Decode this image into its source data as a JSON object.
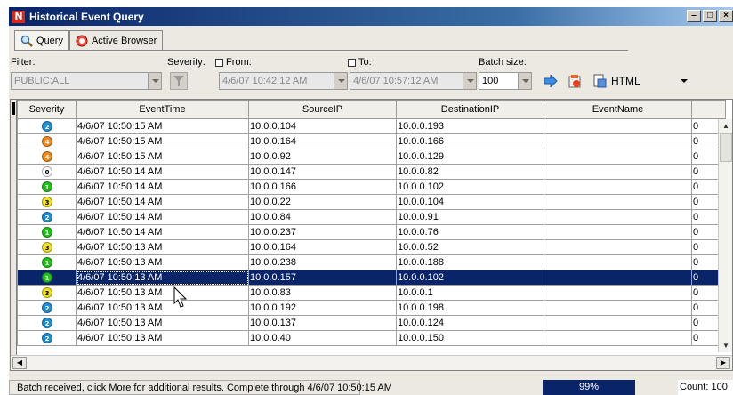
{
  "window": {
    "title": "Historical Event Query",
    "app_icon_letter": "N",
    "controls": [
      "minimize",
      "maximize",
      "close"
    ]
  },
  "tabs": [
    {
      "label": "Query",
      "icon": "magnifier-icon",
      "active": true
    },
    {
      "label": "Active Browser",
      "icon": "browser-icon",
      "active": false
    }
  ],
  "filter": {
    "label": "Filter:",
    "value": "PUBLIC:ALL",
    "enabled": false
  },
  "severity": {
    "label": "Severity:"
  },
  "from": {
    "label": "From:",
    "checked": false,
    "value": "4/6/07 10:42:12 AM"
  },
  "to": {
    "label": "To:",
    "checked": false,
    "value": "4/6/07 10:57:12 AM"
  },
  "batch": {
    "label": "Batch size:",
    "value": "100"
  },
  "export": {
    "format": "HTML"
  },
  "table": {
    "columns": [
      "Severity",
      "EventTime",
      "SourceIP",
      "DestinationIP",
      "EventName",
      ""
    ],
    "rows": [
      {
        "sev": "2",
        "time": "4/6/07 10:50:15 AM",
        "src": "10.0.0.104",
        "dst": "10.0.0.193",
        "name": "",
        "extra": "0"
      },
      {
        "sev": "4",
        "time": "4/6/07 10:50:15 AM",
        "src": "10.0.0.164",
        "dst": "10.0.0.166",
        "name": "",
        "extra": "0"
      },
      {
        "sev": "4",
        "time": "4/6/07 10:50:15 AM",
        "src": "10.0.0.92",
        "dst": "10.0.0.129",
        "name": "",
        "extra": "0"
      },
      {
        "sev": "0",
        "time": "4/6/07 10:50:14 AM",
        "src": "10.0.0.147",
        "dst": "10.0.0.82",
        "name": "",
        "extra": "0"
      },
      {
        "sev": "1",
        "time": "4/6/07 10:50:14 AM",
        "src": "10.0.0.166",
        "dst": "10.0.0.102",
        "name": "",
        "extra": "0"
      },
      {
        "sev": "3",
        "time": "4/6/07 10:50:14 AM",
        "src": "10.0.0.22",
        "dst": "10.0.0.104",
        "name": "",
        "extra": "0"
      },
      {
        "sev": "2",
        "time": "4/6/07 10:50:14 AM",
        "src": "10.0.0.84",
        "dst": "10.0.0.91",
        "name": "",
        "extra": "0"
      },
      {
        "sev": "1",
        "time": "4/6/07 10:50:14 AM",
        "src": "10.0.0.237",
        "dst": "10.0.0.76",
        "name": "",
        "extra": "0"
      },
      {
        "sev": "3",
        "time": "4/6/07 10:50:13 AM",
        "src": "10.0.0.164",
        "dst": "10.0.0.52",
        "name": "",
        "extra": "0"
      },
      {
        "sev": "1",
        "time": "4/6/07 10:50:13 AM",
        "src": "10.0.0.238",
        "dst": "10.0.0.188",
        "name": "",
        "extra": "0"
      },
      {
        "sev": "1",
        "time": "4/6/07 10:50:13 AM",
        "src": "10.0.0.157",
        "dst": "10.0.0.102",
        "name": "",
        "extra": "0",
        "selected": true
      },
      {
        "sev": "3",
        "time": "4/6/07 10:50:13 AM",
        "src": "10.0.0.83",
        "dst": "10.0.0.1",
        "name": "",
        "extra": "0"
      },
      {
        "sev": "2",
        "time": "4/6/07 10:50:13 AM",
        "src": "10.0.0.192",
        "dst": "10.0.0.198",
        "name": "",
        "extra": "0"
      },
      {
        "sev": "2",
        "time": "4/6/07 10:50:13 AM",
        "src": "10.0.0.137",
        "dst": "10.0.0.124",
        "name": "",
        "extra": "0"
      },
      {
        "sev": "2",
        "time": "4/6/07 10:50:13 AM",
        "src": "10.0.0.40",
        "dst": "10.0.0.150",
        "name": "",
        "extra": "0"
      }
    ]
  },
  "severity_colors": {
    "0": "#ffffff",
    "1": "#22c01a",
    "2": "#1f8fd8",
    "3": "#f2e11c",
    "4": "#f08a1a"
  },
  "status": {
    "message": "Batch received, click More for additional results. Complete through 4/6/07 10:50:15 AM",
    "progress": "99%",
    "count": "Count: 100"
  }
}
